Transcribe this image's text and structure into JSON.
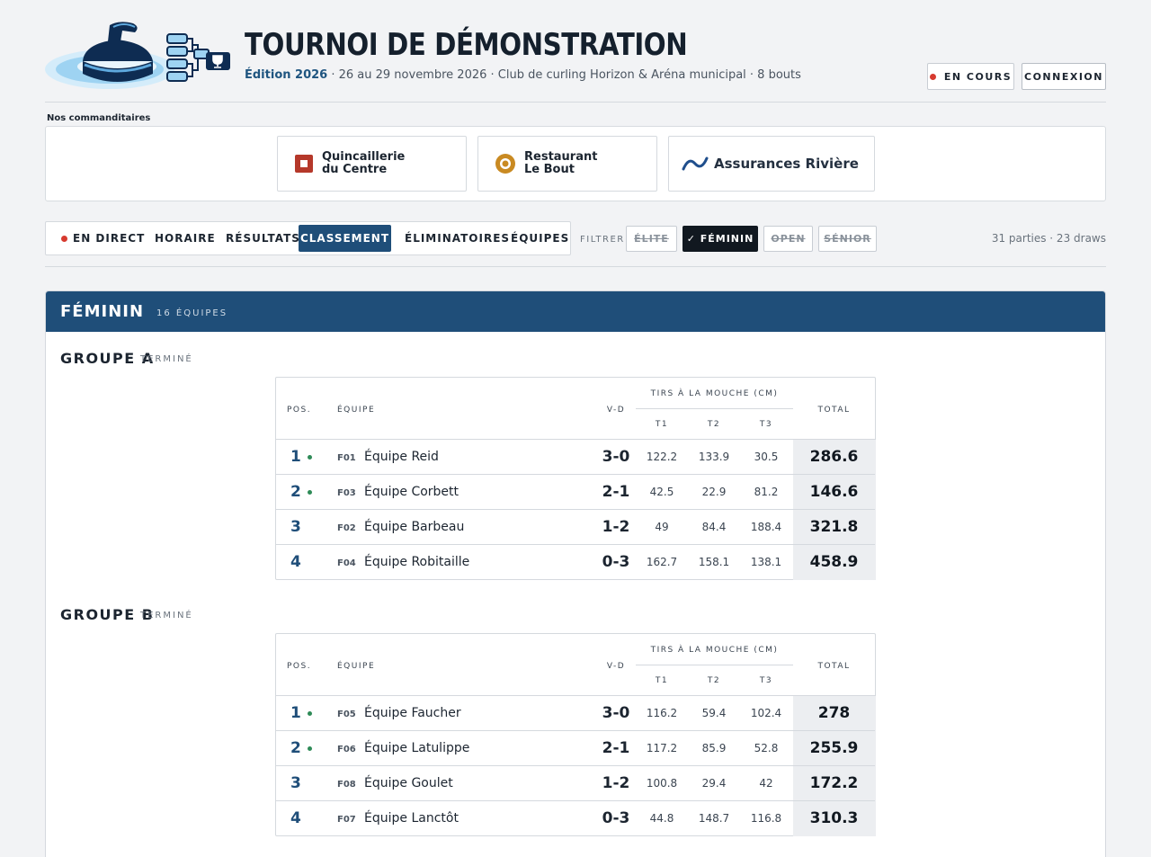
{
  "header": {
    "title": "TOURNOI DE DÉMONSTRATION",
    "edition": "Édition 2026",
    "details": " · 26 au 29 novembre 2026 · Club de curling Horizon & Aréna municipal · 8 bouts",
    "status_label": "EN COURS",
    "login_label": "CONNEXION"
  },
  "sponsors": {
    "label": "Nos commanditaires",
    "items": [
      {
        "name": "Quincaillerie\ndu Centre",
        "icon": "square-icon",
        "color": "#b5382a"
      },
      {
        "name": "Restaurant\nLe Bout",
        "icon": "ring-icon",
        "color": "#c98a22"
      },
      {
        "name": "Assurances Rivière",
        "icon": "wave-icon",
        "color": "#1f4e8c"
      }
    ]
  },
  "nav": {
    "items": [
      "EN DIRECT",
      "HORAIRE",
      "RÉSULTATS",
      "CLASSEMENT",
      "ÉLIMINATOIRES",
      "ÉQUIPES"
    ],
    "active": "CLASSEMENT"
  },
  "filters": {
    "label": "FILTRER",
    "chips": [
      {
        "label": "ÉLITE",
        "selected": false
      },
      {
        "label": "✓ FÉMININ",
        "selected": true
      },
      {
        "label": "OPEN",
        "selected": false
      },
      {
        "label": "SÉNIOR",
        "selected": false
      }
    ]
  },
  "stats": "31 parties · 23 draws",
  "division": {
    "name": "FÉMININ",
    "count": "16 ÉQUIPES"
  },
  "table_headers": {
    "pos": "POS.",
    "team": "ÉQUIPE",
    "vd": "V-D",
    "tirs": "TIRS À LA MOUCHE (CM)",
    "t1": "T1",
    "t2": "T2",
    "t3": "T3",
    "total": "TOTAL"
  },
  "groups": [
    {
      "name": "GROUPE A",
      "status": "TERMINÉ",
      "rows": [
        {
          "pos": "1",
          "qualified": true,
          "code": "F01",
          "team": "Équipe Reid",
          "vd": "3-0",
          "t1": "122.2",
          "t2": "133.9",
          "t3": "30.5",
          "total": "286.6"
        },
        {
          "pos": "2",
          "qualified": true,
          "code": "F03",
          "team": "Équipe Corbett",
          "vd": "2-1",
          "t1": "42.5",
          "t2": "22.9",
          "t3": "81.2",
          "total": "146.6"
        },
        {
          "pos": "3",
          "qualified": false,
          "code": "F02",
          "team": "Équipe Barbeau",
          "vd": "1-2",
          "t1": "49",
          "t2": "84.4",
          "t3": "188.4",
          "total": "321.8"
        },
        {
          "pos": "4",
          "qualified": false,
          "code": "F04",
          "team": "Équipe Robitaille",
          "vd": "0-3",
          "t1": "162.7",
          "t2": "158.1",
          "t3": "138.1",
          "total": "458.9"
        }
      ]
    },
    {
      "name": "GROUPE B",
      "status": "TERMINÉ",
      "rows": [
        {
          "pos": "1",
          "qualified": true,
          "code": "F05",
          "team": "Équipe Faucher",
          "vd": "3-0",
          "t1": "116.2",
          "t2": "59.4",
          "t3": "102.4",
          "total": "278"
        },
        {
          "pos": "2",
          "qualified": true,
          "code": "F06",
          "team": "Équipe Latulippe",
          "vd": "2-1",
          "t1": "117.2",
          "t2": "85.9",
          "t3": "52.8",
          "total": "255.9"
        },
        {
          "pos": "3",
          "qualified": false,
          "code": "F08",
          "team": "Équipe Goulet",
          "vd": "1-2",
          "t1": "100.8",
          "t2": "29.4",
          "t3": "42",
          "total": "172.2"
        },
        {
          "pos": "4",
          "qualified": false,
          "code": "F07",
          "team": "Équipe Lanctôt",
          "vd": "0-3",
          "t1": "44.8",
          "t2": "148.7",
          "t3": "116.8",
          "total": "310.3"
        }
      ]
    }
  ]
}
